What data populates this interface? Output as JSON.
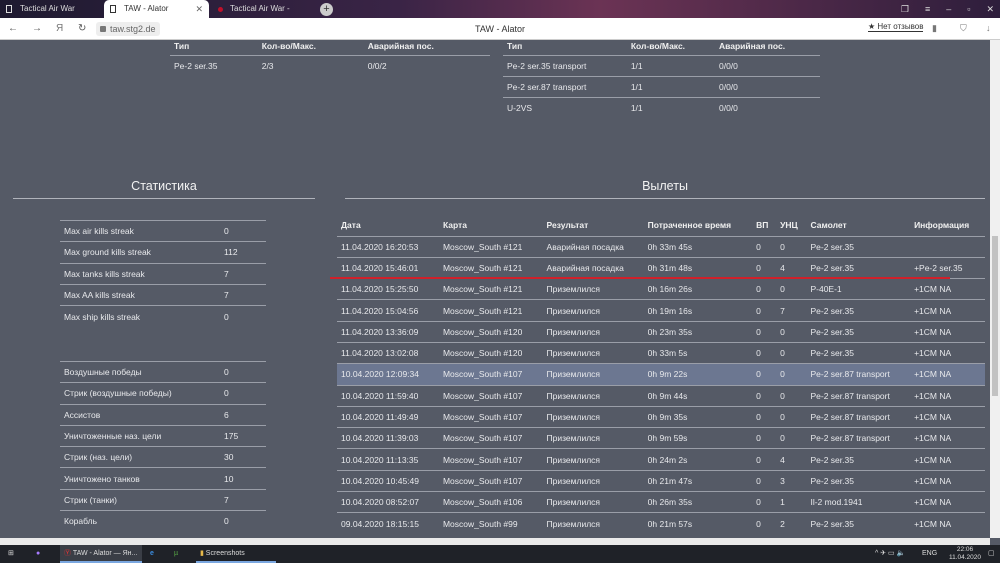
{
  "browser": {
    "tabs": [
      "Tactical Air War",
      "TAW - Alator",
      "Tactical Air War - Страниц"
    ],
    "url": "taw.stg2.de",
    "page_title": "TAW - Alator",
    "reviews": "★ Нет отзывов"
  },
  "top_left_table": {
    "headers": [
      "Тип",
      "Кол-во/Макс.",
      "Аварийная пос."
    ],
    "rows": [
      [
        "Pe-2 ser.35",
        "2/3",
        "0/0/2"
      ]
    ]
  },
  "top_right_table": {
    "headers": [
      "Тип",
      "Кол-во/Макс.",
      "Аварийная пос."
    ],
    "rows": [
      [
        "Pe-2 ser.35 transport",
        "1/1",
        "0/0/0"
      ],
      [
        "Pe-2 ser.87 transport",
        "1/1",
        "0/0/0"
      ],
      [
        "U-2VS",
        "1/1",
        "0/0/0"
      ]
    ]
  },
  "stats": {
    "title": "Статистика",
    "streaks": [
      [
        "Max air kills streak",
        "0"
      ],
      [
        "Max ground kills streak",
        "112"
      ],
      [
        "Max tanks kills streak",
        "7"
      ],
      [
        "Max AA kills streak",
        "7"
      ],
      [
        "Max ship kills streak",
        "0"
      ]
    ],
    "counts": [
      [
        "Воздушные победы",
        "0"
      ],
      [
        "Стрик (воздушные победы)",
        "0"
      ],
      [
        "Ассистов",
        "6"
      ],
      [
        "Уничтоженные наз. цели",
        "175"
      ],
      [
        "Стрик (наз. цели)",
        "30"
      ],
      [
        "Уничтожено танков",
        "10"
      ],
      [
        "Стрик (танки)",
        "7"
      ],
      [
        "Корабль",
        "0"
      ]
    ]
  },
  "flights": {
    "title": "Вылеты",
    "headers": [
      "Дата",
      "Карта",
      "Результат",
      "Потраченное время",
      "ВП",
      "УНЦ",
      "Самолет",
      "Информация"
    ],
    "rows": [
      [
        "11.04.2020 16:20:53",
        "Moscow_South #121",
        "Аварийная посадка",
        "0h 33m 45s",
        "0",
        "0",
        "Pe-2 ser.35",
        ""
      ],
      [
        "11.04.2020 15:46:01",
        "Moscow_South #121",
        "Аварийная посадка",
        "0h 31m 48s",
        "0",
        "4",
        "Pe-2 ser.35",
        "+Pe-2 ser.35"
      ],
      [
        "11.04.2020 15:25:50",
        "Moscow_South #121",
        "Приземлился",
        "0h 16m 26s",
        "0",
        "0",
        "P-40E-1",
        "+1CM NA"
      ],
      [
        "11.04.2020 15:04:56",
        "Moscow_South #121",
        "Приземлился",
        "0h 19m 16s",
        "0",
        "7",
        "Pe-2 ser.35",
        "+1CM NA"
      ],
      [
        "11.04.2020 13:36:09",
        "Moscow_South #120",
        "Приземлился",
        "0h 23m 35s",
        "0",
        "0",
        "Pe-2 ser.35",
        "+1CM NA"
      ],
      [
        "11.04.2020 13:02:08",
        "Moscow_South #120",
        "Приземлился",
        "0h 33m 5s",
        "0",
        "0",
        "Pe-2 ser.35",
        "+1CM NA"
      ],
      [
        "10.04.2020 12:09:34",
        "Moscow_South #107",
        "Приземлился",
        "0h 9m 22s",
        "0",
        "0",
        "Pe-2 ser.87 transport",
        "+1CM NA"
      ],
      [
        "10.04.2020 11:59:40",
        "Moscow_South #107",
        "Приземлился",
        "0h 9m 44s",
        "0",
        "0",
        "Pe-2 ser.87 transport",
        "+1CM NA"
      ],
      [
        "10.04.2020 11:49:49",
        "Moscow_South #107",
        "Приземлился",
        "0h 9m 35s",
        "0",
        "0",
        "Pe-2 ser.87 transport",
        "+1CM NA"
      ],
      [
        "10.04.2020 11:39:03",
        "Moscow_South #107",
        "Приземлился",
        "0h 9m 59s",
        "0",
        "0",
        "Pe-2 ser.87 transport",
        "+1CM NA"
      ],
      [
        "10.04.2020 11:13:35",
        "Moscow_South #107",
        "Приземлился",
        "0h 24m 2s",
        "0",
        "4",
        "Pe-2 ser.35",
        "+1CM NA"
      ],
      [
        "10.04.2020 10:45:49",
        "Moscow_South #107",
        "Приземлился",
        "0h 21m 47s",
        "0",
        "3",
        "Pe-2 ser.35",
        "+1CM NA"
      ],
      [
        "10.04.2020 08:52:07",
        "Moscow_South #106",
        "Приземлился",
        "0h 26m 35s",
        "0",
        "1",
        "Il-2 mod.1941",
        "+1CM NA"
      ],
      [
        "09.04.2020 18:15:15",
        "Moscow_South #99",
        "Приземлился",
        "0h 21m 57s",
        "0",
        "2",
        "Pe-2 ser.35",
        "+1CM NA"
      ]
    ]
  },
  "taskbar": {
    "items": [
      "TAW - Alator — Ян...",
      "Screenshots"
    ],
    "lang": "ENG",
    "time": "22:06",
    "date": "11.04.2020"
  }
}
